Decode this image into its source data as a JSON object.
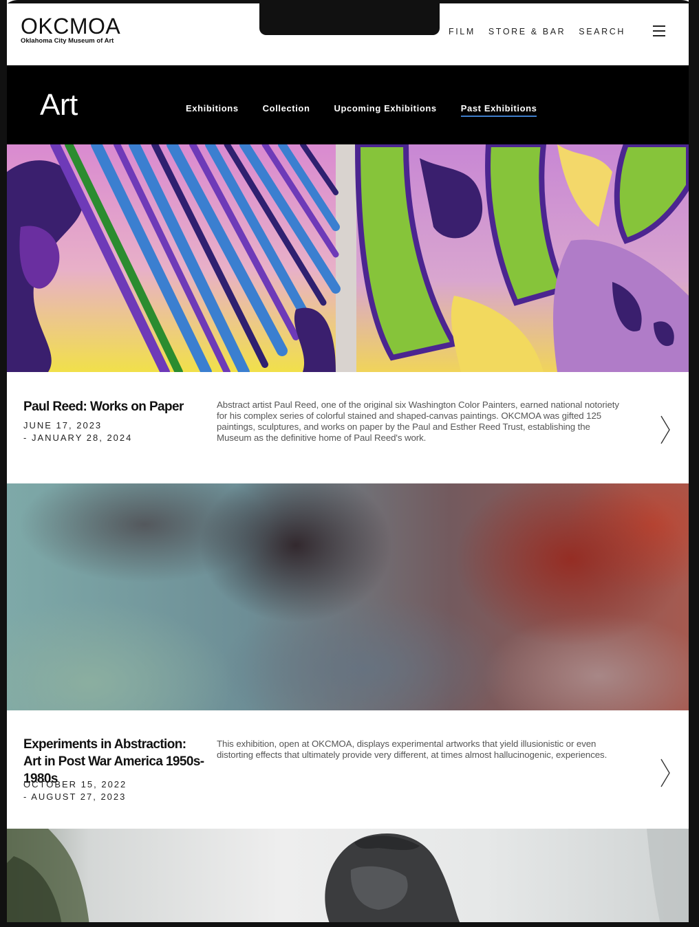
{
  "header": {
    "logo_main": "OKCMOA",
    "logo_sub": "Oklahoma City Museum of Art",
    "nav": [
      "FILM",
      "STORE & BAR",
      "SEARCH"
    ]
  },
  "section": {
    "title": "Art",
    "links": [
      "Exhibitions",
      "Collection",
      "Upcoming Exhibitions",
      "Past Exhibitions"
    ],
    "active_link": "Past Exhibitions",
    "accent_color": "#3f7ecc"
  },
  "exhibitions": [
    {
      "title": "Paul Reed: Works on Paper",
      "date_start": "JUNE 17, 2023",
      "date_end": " - JANUARY 28, 2024",
      "description": "Abstract artist Paul Reed, one of the original six Washington Color Painters, earned national notoriety for his complex series of colorful stained and shaped-canvas paintings. OKCMOA was gifted 125 paintings, sculptures, and works on paper by the Paul and Esther Reed Trust, establishing the Museum as the definitive home of Paul Reed's work."
    },
    {
      "title": "Experiments in Abstraction: Art in Post War America 1950s-1980s",
      "date_start": "OCTOBER 15, 2022",
      "date_end": " - AUGUST 27, 2023",
      "description": "This exhibition, open at OKCMOA, displays experimental artworks that yield illusionistic or even distorting effects that ultimately provide very different, at times almost hallucinogenic, experiences."
    }
  ],
  "icons": {
    "menu": "hamburger-icon",
    "arrow": "chevron-right-icon"
  }
}
